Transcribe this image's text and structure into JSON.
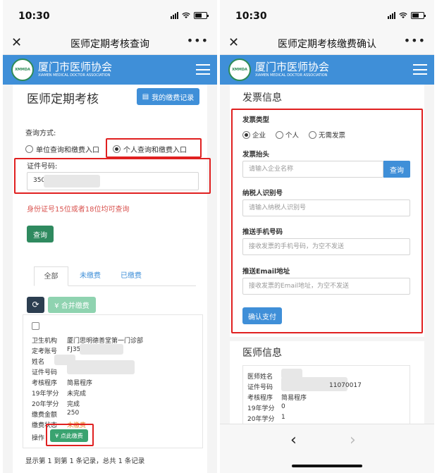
{
  "status_time": "10:30",
  "left": {
    "nav_title": "医师定期考核查询",
    "brand_name": "厦门市医师协会",
    "brand_sub": "XIAMEN MEDICAL DOCTOR ASSOCIATION",
    "logo_text": "XMMDA",
    "page_title": "医师定期考核",
    "payment_records_button": "我的缴费记录",
    "query_method_label": "查询方式:",
    "radio_unit": "单位查询和缴费入口",
    "radio_personal": "个人查询和缴费入口",
    "cert_label": "证件号码:",
    "cert_value": "350",
    "hint": "身份证号15位或者18位均可查询",
    "query_button": "查询",
    "tabs": [
      "全部",
      "未缴费",
      "已缴费"
    ],
    "merge_pay_button": "¥ 合并缴费",
    "record": {
      "institution_label": "卫生机构",
      "institution_value": "厦门思明德善堂第一门诊部",
      "account_label": "定考账号",
      "account_value": "FJ35",
      "name_label": "姓名",
      "cert_label": "证件号码",
      "program_label": "考核程序",
      "program_value": "简易程序",
      "credit19_label": "19年学分",
      "credit19_value": "未完成",
      "credit20_label": "20年学分",
      "credit20_value": "完成",
      "amount_label": "缴费金额",
      "amount_value": "250",
      "status_label": "缴费状态",
      "status_value": "未缴费",
      "action_label": "操作",
      "pay_button": "¥ 点此缴费"
    },
    "footer_text": "显示第 1 到第 1 条记录，总共 1 条记录"
  },
  "right": {
    "nav_title": "医师定期考核缴费确认",
    "brand_name": "厦门市医师协会",
    "brand_sub": "XIAMEN MEDICAL DOCTOR ASSOCIATION",
    "logo_text": "XMMDA",
    "invoice_section_title": "发票信息",
    "invoice_type_label": "发票类型",
    "invoice_types": [
      "企业",
      "个人",
      "无需发票"
    ],
    "invoice_header_label": "发票抬头",
    "invoice_header_placeholder": "请输入企业名称",
    "invoice_query_button": "查询",
    "taxpayer_id_label": "纳税人识别号",
    "taxpayer_id_placeholder": "请输入纳税人识别号",
    "phone_label": "推送手机号码",
    "phone_placeholder": "接收发票的手机号码，为空不发送",
    "email_label": "推送Email地址",
    "email_placeholder": "接收发票的Email地址，为空不发送",
    "confirm_button": "确认支付",
    "doctor_section_title": "医师信息",
    "doctor_info": {
      "name_label": "医师姓名",
      "cert_label": "证件号码",
      "cert_value": "11070017",
      "program_label": "考核程序",
      "program_value": "简易程序",
      "credit19_label": "19年学分",
      "credit19_value": "0",
      "credit20_label": "20年学分",
      "credit20_value": "1"
    }
  }
}
